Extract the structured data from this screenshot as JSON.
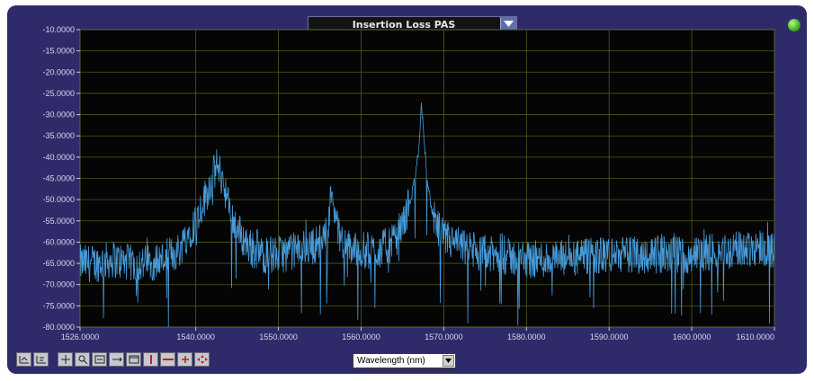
{
  "header": {
    "measurement_select": {
      "value": "Insertion Loss PAS"
    },
    "status_led_color": "#3fae1e"
  },
  "x_axis_select": {
    "value": "Wavelength (nm)"
  },
  "toolbar": {
    "icons": [
      "axis-scale-icon",
      "axis-label-icon",
      "pan-icon",
      "zoom-icon",
      "zoom-fit-icon",
      "marker-icon",
      "window-icon",
      "vertical-marker-icon",
      "horizontal-marker-icon",
      "marker-add-icon",
      "move-icon"
    ]
  },
  "chart_data": {
    "type": "line",
    "xlim": [
      1526.0,
      1610.0
    ],
    "ylim": [
      -80.0,
      -10.0
    ],
    "x_ticks": [
      "1526.0000",
      "1540.0000",
      "1550.0000",
      "1560.0000",
      "1570.0000",
      "1580.0000",
      "1590.0000",
      "1600.0000",
      "1610.0000"
    ],
    "y_ticks": [
      "-10.0000",
      "-15.0000",
      "-20.0000",
      "-25.0000",
      "-30.0000",
      "-35.0000",
      "-40.0000",
      "-45.0000",
      "-50.0000",
      "-55.0000",
      "-60.0000",
      "-65.0000",
      "-70.0000",
      "-75.0000",
      "-80.0000"
    ],
    "grid": true,
    "series_color": "#4aa3e6",
    "series": [
      {
        "x": [
          1526,
          1528,
          1530,
          1532,
          1534,
          1536,
          1537,
          1538,
          1539,
          1540,
          1541,
          1542,
          1542.5,
          1543,
          1543.5,
          1544,
          1545,
          1546,
          1547,
          1548,
          1550,
          1552,
          1554,
          1555,
          1556,
          1556.5,
          1557,
          1558,
          1560,
          1562,
          1564,
          1565,
          1566,
          1566.5,
          1567,
          1567.3,
          1567.6,
          1568,
          1568.5,
          1569,
          1570,
          1572,
          1575,
          1580,
          1585,
          1590,
          1595,
          1600,
          1605,
          1608,
          1610
        ],
        "y": [
          -65,
          -65,
          -64,
          -65,
          -65,
          -64,
          -63,
          -62,
          -58,
          -55,
          -50,
          -45,
          -42,
          -44,
          -47,
          -52,
          -57,
          -60,
          -62,
          -63,
          -63,
          -62,
          -61,
          -60,
          -57,
          -46,
          -56,
          -61,
          -62,
          -62,
          -60,
          -56,
          -50,
          -45,
          -38,
          -28,
          -35,
          -45,
          -52,
          -56,
          -59,
          -61,
          -63,
          -64,
          -64,
          -63,
          -63,
          -63,
          -62,
          -61,
          -62
        ]
      }
    ]
  }
}
